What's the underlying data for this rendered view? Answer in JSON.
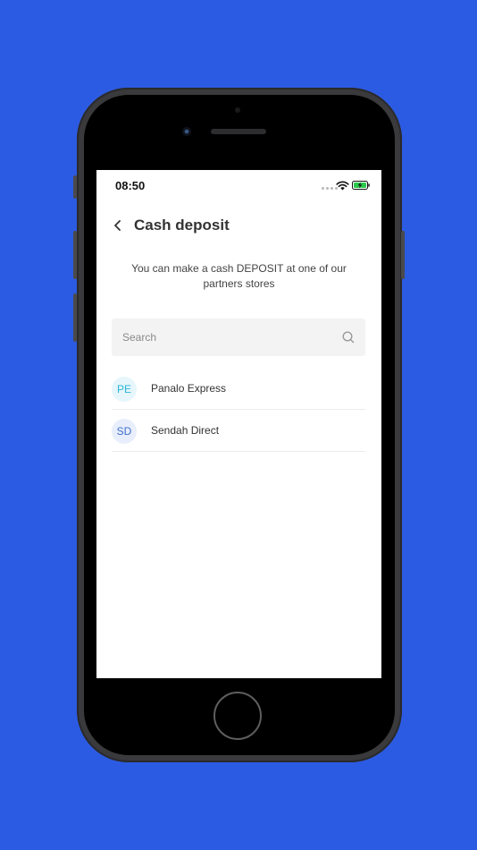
{
  "status_bar": {
    "time": "08:50"
  },
  "header": {
    "title": "Cash deposit",
    "back_icon": "chevron-left-icon"
  },
  "subtitle": {
    "line1": "You can make a cash DEPOSIT at one of our",
    "line2": "partners stores"
  },
  "search": {
    "placeholder": "Search",
    "value": "",
    "icon": "search-icon"
  },
  "partners": [
    {
      "initials": "PE",
      "name": "Panalo Express",
      "avatar_bg": "#e6f6fb",
      "avatar_color": "#2bb5d6"
    },
    {
      "initials": "SD",
      "name": "Sendah Direct",
      "avatar_bg": "#e8eefb",
      "avatar_color": "#3f6fcf"
    }
  ],
  "colors": {
    "background": "#2c5be3",
    "screen": "#ffffff",
    "search_bg": "#f3f3f3",
    "battery": "#2bc84c"
  }
}
